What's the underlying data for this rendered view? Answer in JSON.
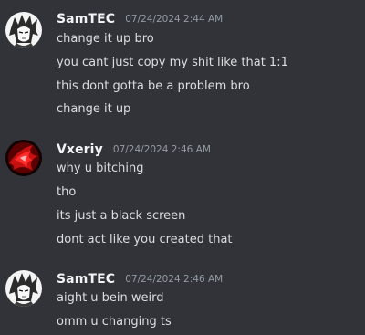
{
  "colors": {
    "background": "#313338",
    "username": "#f2f3f5",
    "timestamp": "#949ba4",
    "message_text": "#dbdee1"
  },
  "messages": [
    {
      "author": "SamTEC",
      "avatar_icon": "anime-character-avatar-icon",
      "timestamp": "07/24/2024 2:44 AM",
      "lines": [
        "change it up bro",
        "you cant just copy my shit like that 1:1",
        "this dont gotta be a problem bro",
        "change it up"
      ]
    },
    {
      "author": "Vxeriy",
      "avatar_icon": "red-abstract-avatar-icon",
      "timestamp": "07/24/2024 2:46 AM",
      "lines": [
        "why u bitching",
        "tho",
        "its just a black screen",
        "dont act like you created that"
      ]
    },
    {
      "author": "SamTEC",
      "avatar_icon": "anime-character-avatar-icon",
      "timestamp": "07/24/2024 2:46 AM",
      "lines": [
        "aight u bein weird",
        "omm u changing ts"
      ]
    }
  ]
}
